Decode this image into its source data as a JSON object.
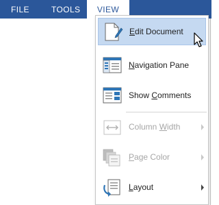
{
  "ribbon": {
    "tabs": [
      {
        "label": "FILE"
      },
      {
        "label": "TOOLS"
      },
      {
        "label": "VIEW"
      }
    ]
  },
  "view_menu": {
    "items": [
      {
        "pre": "",
        "key": "E",
        "post": "dit Document",
        "state": "hover",
        "icon": "edit-document-icon"
      },
      {
        "pre": "",
        "key": "N",
        "post": "avigation Pane",
        "state": "enabled",
        "icon": "navigation-pane-icon"
      },
      {
        "pre": "Show ",
        "key": "C",
        "post": "omments",
        "state": "enabled",
        "icon": "show-comments-icon"
      },
      {
        "pre": "Column ",
        "key": "W",
        "post": "idth",
        "state": "disabled",
        "icon": "column-width-icon",
        "submenu": true
      },
      {
        "pre": "",
        "key": "P",
        "post": "age Color",
        "state": "disabled",
        "icon": "page-color-icon",
        "submenu": true
      },
      {
        "pre": "",
        "key": "L",
        "post": "ayout",
        "state": "enabled",
        "icon": "layout-icon",
        "submenu": true
      }
    ]
  },
  "colors": {
    "ribbon": "#2b579a",
    "hover": "#c5d9f1",
    "icon_blue": "#2e75b6",
    "disabled_text": "#a6a6a6"
  }
}
